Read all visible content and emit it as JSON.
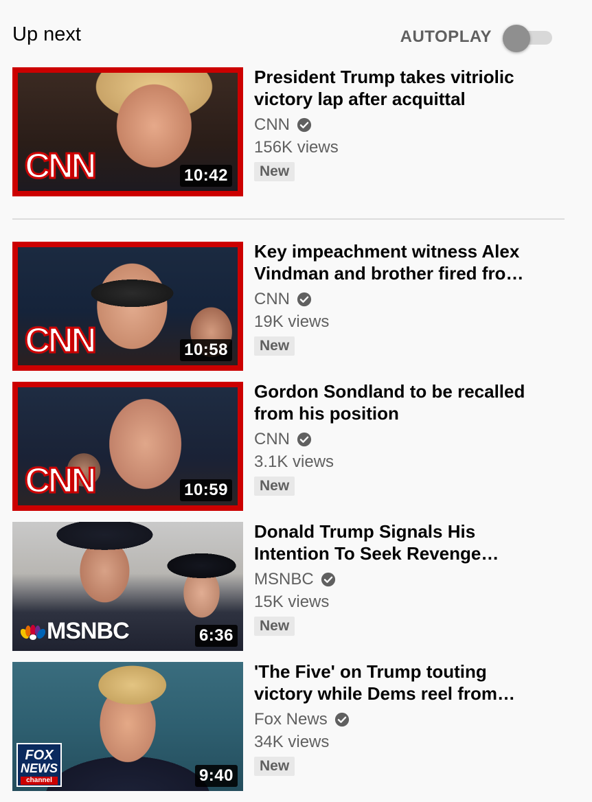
{
  "header": {
    "title": "Up next",
    "autoplay_label": "AUTOPLAY",
    "autoplay_on": false
  },
  "videos": [
    {
      "title": "President Trump takes vitriolic victory lap after acquittal",
      "channel": "CNN",
      "verified": true,
      "views": "156K views",
      "badge": "New",
      "duration": "10:42",
      "logo": "CNN"
    },
    {
      "title": "Key impeachment witness Alex Vindman and brother fired fro…",
      "channel": "CNN",
      "verified": true,
      "views": "19K views",
      "badge": "New",
      "duration": "10:58",
      "logo": "CNN"
    },
    {
      "title": "Gordon Sondland to be recalled from his position",
      "channel": "CNN",
      "verified": true,
      "views": "3.1K views",
      "badge": "New",
      "duration": "10:59",
      "logo": "CNN"
    },
    {
      "title": "Donald Trump Signals His Intention To Seek Revenge…",
      "channel": "MSNBC",
      "verified": true,
      "views": "15K views",
      "badge": "New",
      "duration": "6:36",
      "logo": "MSNBC"
    },
    {
      "title": "'The Five' on Trump touting victory while Dems reel from…",
      "channel": "Fox News",
      "verified": true,
      "views": "34K views",
      "badge": "New",
      "duration": "9:40",
      "logo_lines": [
        "FOX",
        "NEWS",
        "channel"
      ]
    }
  ],
  "colors": {
    "cnn_red": "#cc0000",
    "text_primary": "#030303",
    "text_secondary": "#606060",
    "badge_bg": "#e8e8e8",
    "background": "#f9f9f9"
  },
  "icons": {
    "verified": "verified-check-icon",
    "toggle": "autoplay-toggle"
  }
}
